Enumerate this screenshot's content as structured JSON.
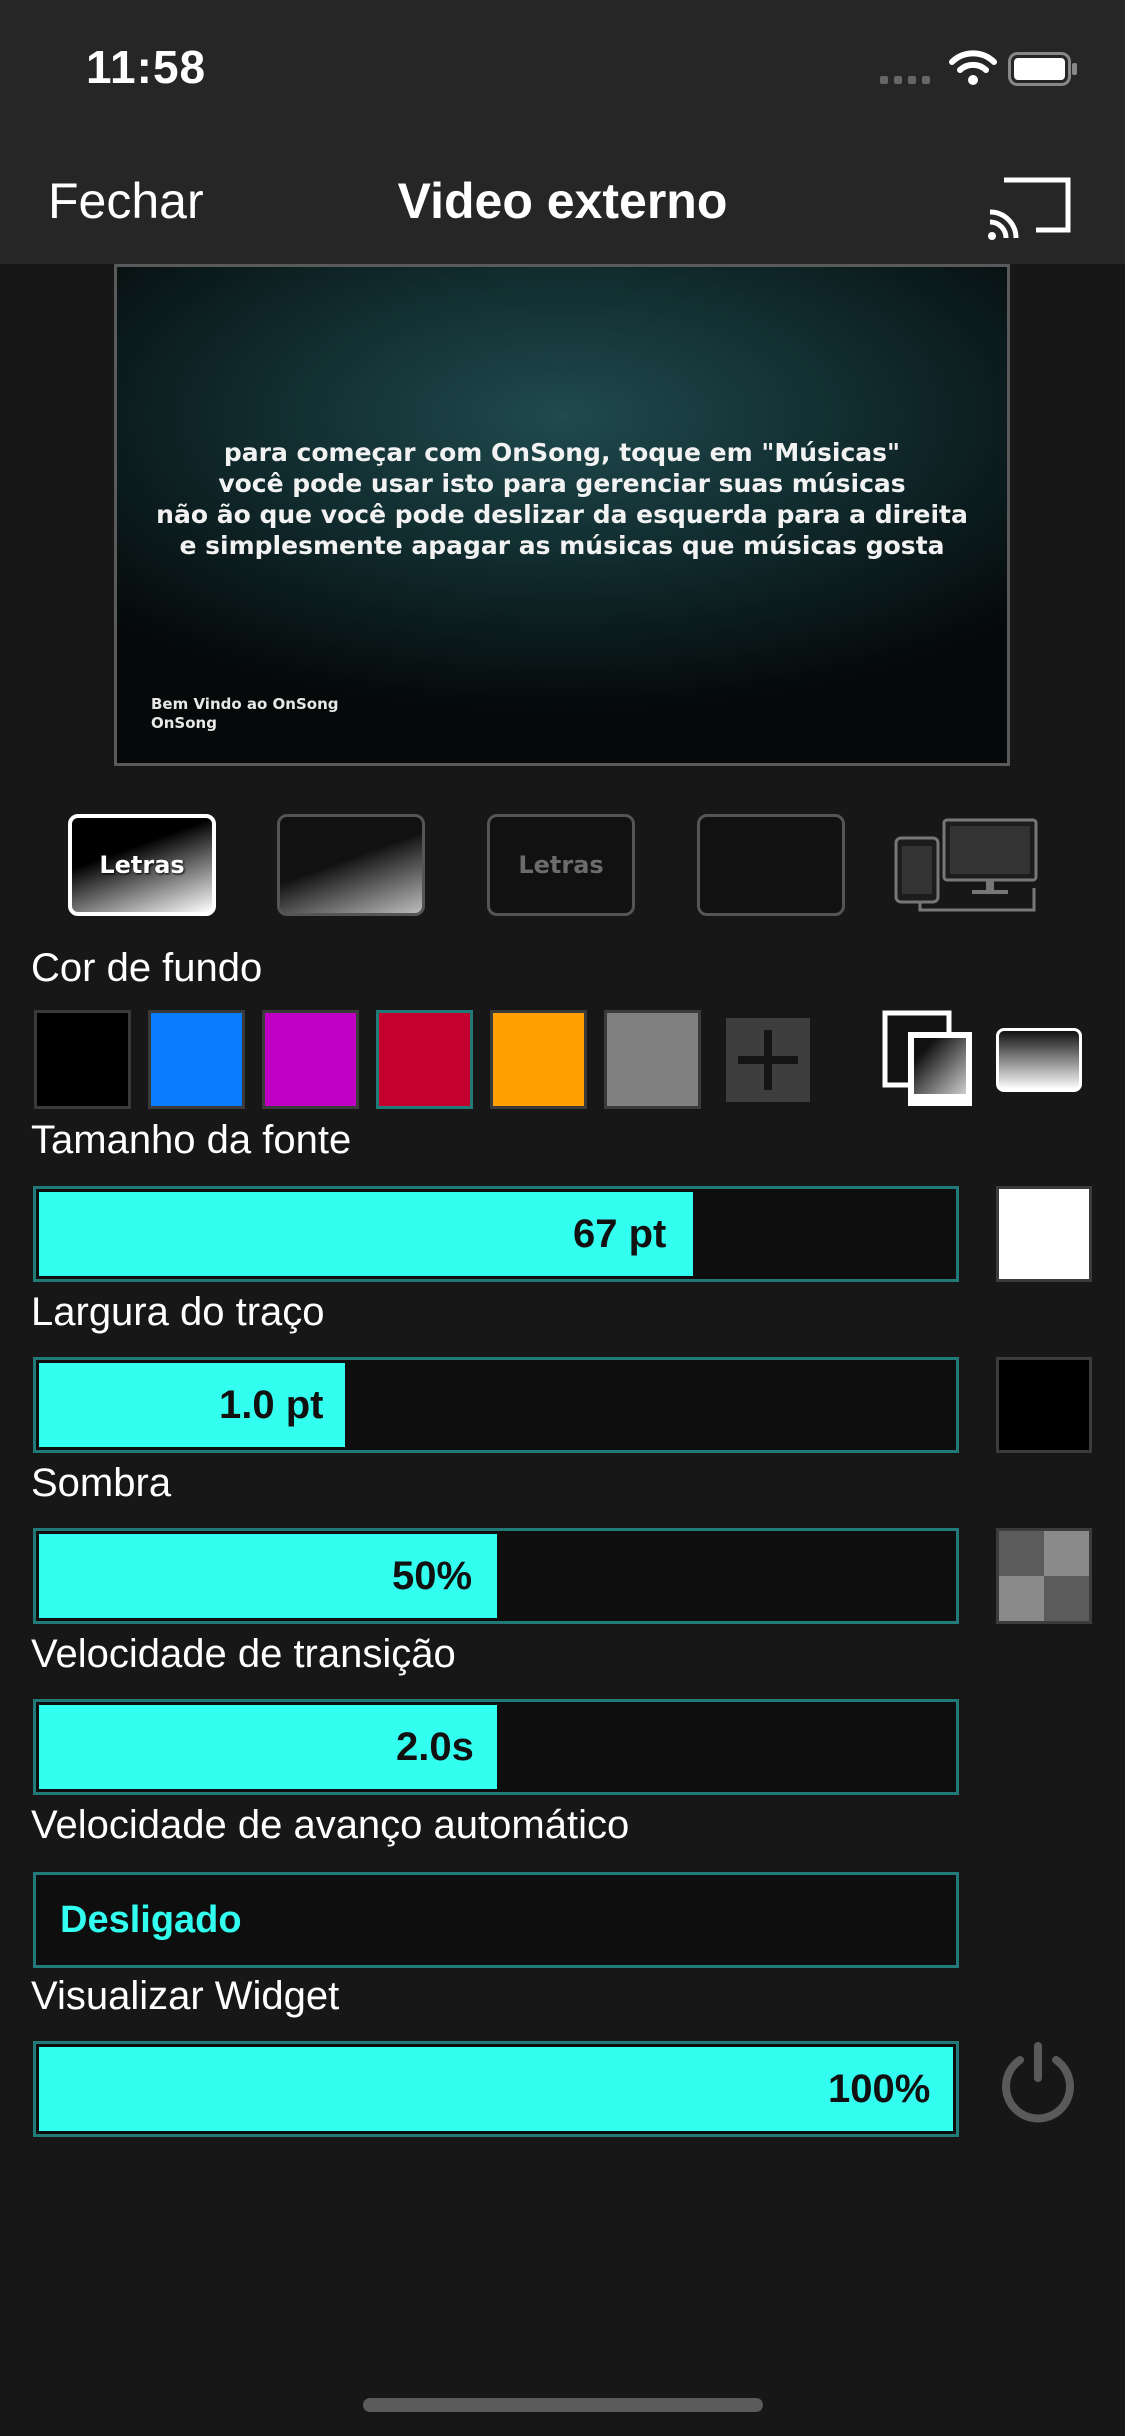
{
  "status": {
    "time": "11:58"
  },
  "nav": {
    "close_label": "Fechar",
    "title": "Video externo"
  },
  "preview": {
    "lines": [
      "para começar com OnSong, toque em \"Músicas\"",
      "você pode usar isto para gerenciar suas músicas",
      "não ão que você pode deslizar da esquerda para a direita",
      "e simplesmente apagar as músicas que músicas gosta"
    ],
    "footer": [
      "Bem Vindo ao OnSong",
      "OnSong"
    ]
  },
  "themes": {
    "lyrics_label": "Letras"
  },
  "background": {
    "label": "Cor de fundo",
    "swatches": [
      "#000000",
      "#0a7cff",
      "#bf00c4",
      "#c4002e",
      "#ff9f00",
      "#808080"
    ]
  },
  "font_size": {
    "label": "Tamanho da fonte",
    "value": "67 pt",
    "fill_fraction": 0.71,
    "color": "#ffffff"
  },
  "stroke_width": {
    "label": "Largura do traço",
    "value": "1.0 pt",
    "fill_fraction": 0.33,
    "color": "#000000"
  },
  "shadow": {
    "label": "Sombra",
    "value": "50%",
    "fill_fraction": 0.5
  },
  "transition": {
    "label": "Velocidade de transição",
    "value": "2.0s",
    "fill_fraction": 0.5
  },
  "auto_advance": {
    "label": "Velocidade de avanço automático",
    "value": "Desligado"
  },
  "widget": {
    "label": "Visualizar Widget",
    "value": "100%",
    "fill_fraction": 1.0
  },
  "colors": {
    "accent": "#33fff0",
    "accent_border": "#207a78",
    "background": "#171717",
    "bar": "#262626"
  }
}
